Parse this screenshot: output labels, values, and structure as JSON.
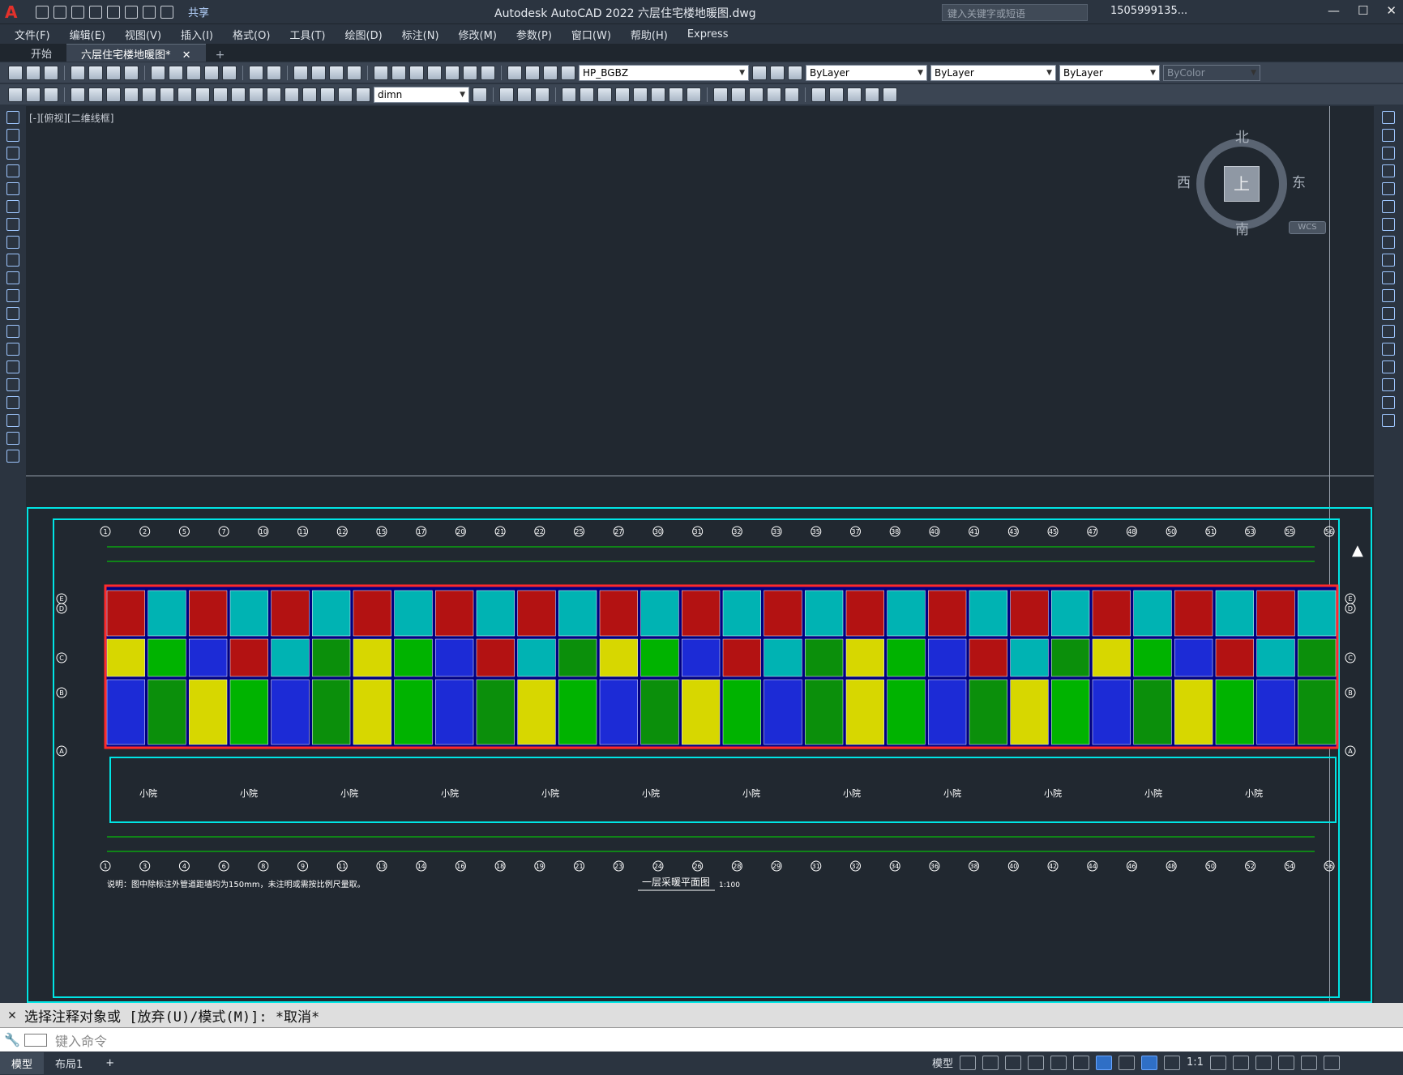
{
  "app": {
    "logo": "A",
    "title": "Autodesk AutoCAD 2022    六层住宅楼地暖图.dwg",
    "share_label": "共享",
    "search_placeholder": "键入关键字或短语",
    "user": "1505999135...",
    "window_controls": [
      "—",
      "☐",
      "✕"
    ]
  },
  "menu": {
    "items": [
      "文件(F)",
      "编辑(E)",
      "视图(V)",
      "插入(I)",
      "格式(O)",
      "工具(T)",
      "绘图(D)",
      "标注(N)",
      "修改(M)",
      "参数(P)",
      "窗口(W)",
      "帮助(H)",
      "Express"
    ]
  },
  "tabs": {
    "start": "开始",
    "active": "六层住宅楼地暖图*",
    "close": "✕",
    "add": "+"
  },
  "toolbar": {
    "layer": "HP_BGBZ",
    "color": "ByLayer",
    "linetype": "ByLayer",
    "lineweight": "ByLayer",
    "plotstyle": "ByColor",
    "dimstyle": "dimn"
  },
  "viewport": {
    "label": "[-][俯视][二维线框]",
    "viewcube": {
      "north": "北",
      "south": "南",
      "east": "东",
      "west": "西",
      "top": "上",
      "wcs": "WCS"
    }
  },
  "drawing": {
    "title": "一层采暖平面图",
    "scale": "1:100",
    "note": "说明：图中除标注外管道距墙均为150mm，未注明或需按比例尺量取。",
    "yard_labels": [
      "小院",
      "小院",
      "小院",
      "小院",
      "小院",
      "小院",
      "小院",
      "小院",
      "小院",
      "小院",
      "小院",
      "小院"
    ],
    "axis_top": [
      "1",
      "2",
      "5",
      "7",
      "10",
      "11",
      "12",
      "15",
      "17",
      "20",
      "21",
      "22",
      "25",
      "27",
      "30",
      "31",
      "32",
      "33",
      "35",
      "37",
      "38",
      "40",
      "41",
      "43",
      "45",
      "47",
      "48",
      "50",
      "51",
      "53",
      "55",
      "56"
    ],
    "axis_bottom": [
      "1",
      "3",
      "4",
      "6",
      "8",
      "9",
      "11",
      "13",
      "14",
      "16",
      "18",
      "19",
      "21",
      "23",
      "24",
      "26",
      "28",
      "29",
      "31",
      "32",
      "34",
      "36",
      "38",
      "40",
      "42",
      "44",
      "46",
      "48",
      "50",
      "52",
      "54",
      "56"
    ],
    "axis_side": [
      "E",
      "D",
      "C",
      "B",
      "A"
    ]
  },
  "command": {
    "history": "选择注释对象或 [放弃(U)/模式(M)]: *取消*",
    "placeholder": "键入命令"
  },
  "status": {
    "model_tab": "模型",
    "layout_tab": "布局1",
    "add": "+",
    "model_label": "模型",
    "scale": "1:1"
  }
}
